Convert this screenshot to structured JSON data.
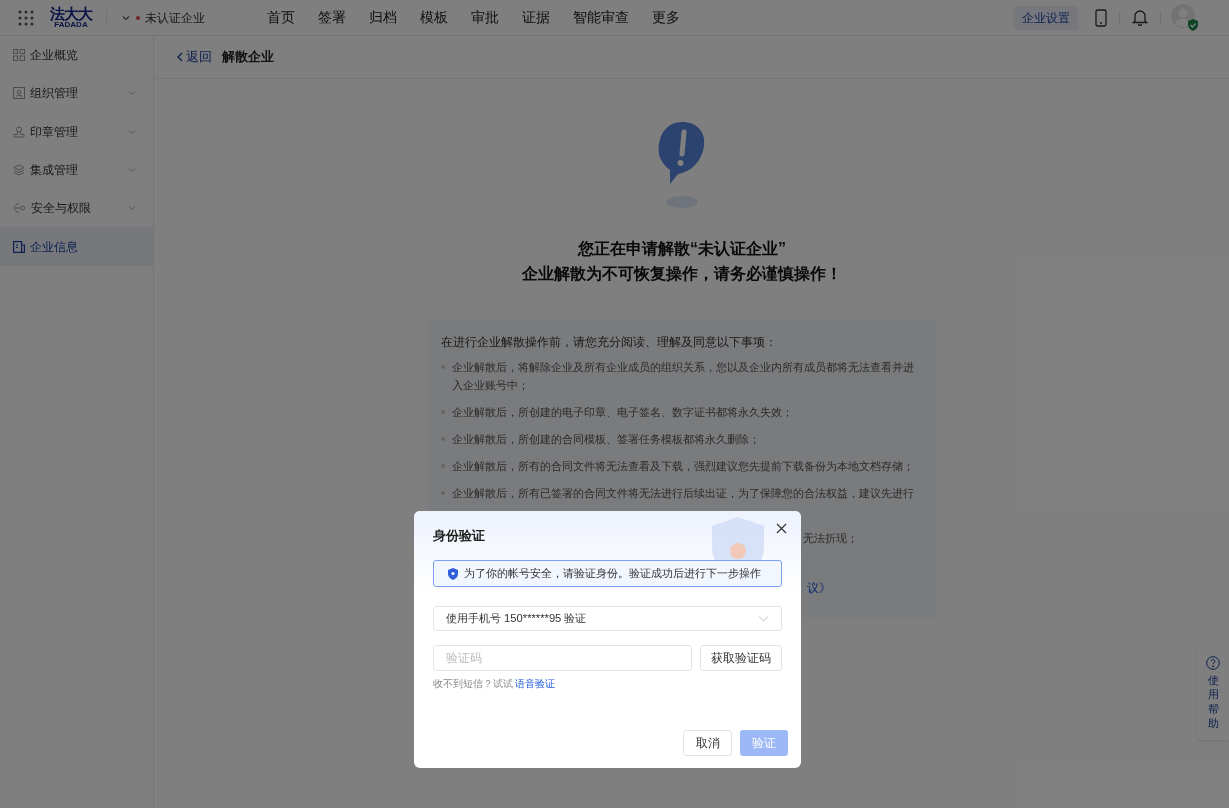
{
  "topbar": {
    "brand": "法大大",
    "brand_sub": "FADADA",
    "company": "未认证企业",
    "nav": [
      {
        "label": "首页",
        "selected": false
      },
      {
        "label": "签署",
        "selected": false
      },
      {
        "label": "归档",
        "selected": false
      },
      {
        "label": "模板",
        "selected": false
      },
      {
        "label": "审批",
        "selected": false
      },
      {
        "label": "证据",
        "selected": false
      },
      {
        "label": "智能审查",
        "selected": false
      },
      {
        "label": "更多",
        "selected": false
      }
    ],
    "settings_button": {
      "label": "企业设置",
      "selected": true
    }
  },
  "sidebar": {
    "items": [
      {
        "label": "企业概览",
        "kind": "link",
        "selected": false
      },
      {
        "label": "组织管理",
        "kind": "group",
        "selected": false
      },
      {
        "label": "印章管理",
        "kind": "group",
        "selected": false
      },
      {
        "label": "集成管理",
        "kind": "group",
        "selected": false
      },
      {
        "label": "安全与权限",
        "kind": "group",
        "selected": false
      },
      {
        "label": "企业信息",
        "kind": "link",
        "selected": true
      }
    ]
  },
  "page": {
    "back": "返回",
    "title": "解散企业",
    "heading": [
      "您正在申请解散“未认证企业”",
      "企业解散为不可恢复操作，请务必谨慎操作！"
    ],
    "notice": {
      "intro": "在进行企业解散操作前，请您充分阅读、理解及同意以下事项：",
      "items": [
        "企业解散后，将解除企业及所有企业成员的组织关系，您以及企业内所有成员都将无法查看并进入企业账号中；",
        "企业解散后，所创建的电子印章、电子签名、数字证书都将永久失效；",
        "企业解散后，所创建的合同模板、签署任务模板都将永久删除；",
        "企业解散后，所有的合同文件将无法查看及下载，强烈建议您先提前下载备份为本地文档存储；",
        "企业解散后，所有已签署的合同文件将无法进行后续出证，为了保障您的合法权益，建议先进行",
        "无法折现；"
      ],
      "link": "议》"
    }
  },
  "help": {
    "label": "使用帮助"
  },
  "dialog": {
    "title": "身份验证",
    "info": "为了你的帐号安全，请验证身份。验证成功后进行下一步操作",
    "method": "使用手机号 150******95 验证",
    "code": {
      "placeholder": "验证码"
    },
    "send_button": "获取验证码",
    "hint": "收不到短信？试试",
    "hint_link": "语音验证",
    "cancel": "取消",
    "confirm": {
      "label": "验证",
      "disabled": true
    }
  }
}
